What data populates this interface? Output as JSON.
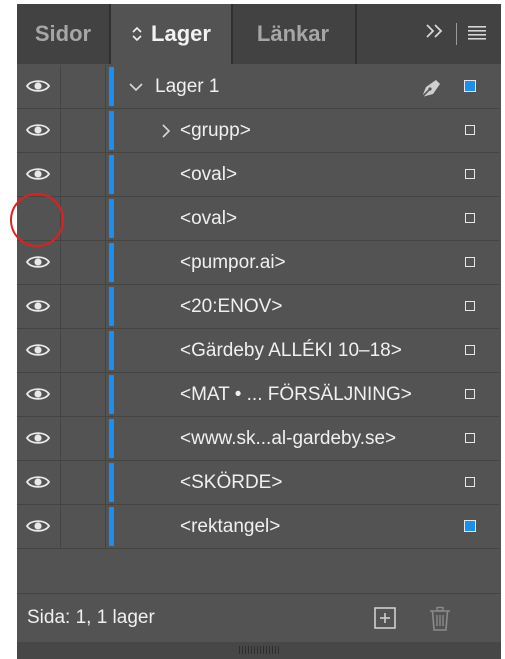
{
  "tabs": {
    "sidor": "Sidor",
    "lager": "Lager",
    "lankar": "Länkar"
  },
  "tabbar_icons": [
    "double-chevron-icon",
    "panel-menu-icon"
  ],
  "layer": {
    "name": "Lager 1",
    "color": "#1a8ff0"
  },
  "rows": [
    {
      "label": "<grupp>",
      "visible": true
    },
    {
      "label": "<oval>",
      "visible": true
    },
    {
      "label": "<oval>",
      "visible": false
    },
    {
      "label": "<pumpor.ai>",
      "visible": true
    },
    {
      "label": "<20:ENOV>",
      "visible": true
    },
    {
      "label": "<Gärdeby ALLÉKI 10–18>",
      "visible": true
    },
    {
      "label": "<MAT • ... FÖRSÄLJNING>",
      "visible": true
    },
    {
      "label": "<www.sk...al-gardeby.se>",
      "visible": true
    },
    {
      "label": "<SKÖRDE>",
      "visible": true
    },
    {
      "label": "<rektangel>",
      "visible": true
    }
  ],
  "footer": {
    "status": "Sida: 1, 1 lager"
  },
  "colors": {
    "panel_bg": "#535353",
    "tabbar_bg": "#424242",
    "accent_blue": "#1a8ff0",
    "annotation_red": "#e02020"
  }
}
